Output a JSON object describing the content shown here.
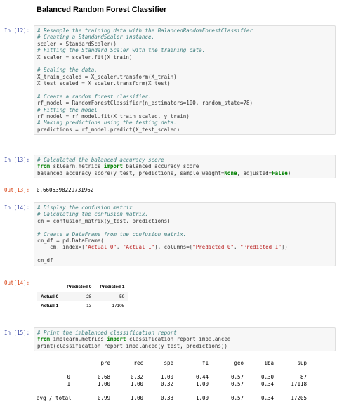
{
  "title": "Balanced Random Forest Classifier",
  "cell12": {
    "prompt": "In [12]:",
    "lines": [
      "# Resample the training data with the BalancedRandomForestClassifier",
      "# Creating a StandardScaler instance.",
      "scaler = StandardScaler()",
      "# Fitting the Standard Scaler with the training data.",
      "X_scaler = scaler.fit(X_train)",
      "",
      "# Scaling the data.",
      "X_train_scaled = X_scaler.transform(X_train)",
      "X_test_scaled = X_scaler.transform(X_test)",
      "",
      "# Create a random forest classifier.",
      "rf_model = RandomForestClassifier(n_estimators=100, random_state=78)",
      "# Fitting the model",
      "rf_model = rf_model.fit(X_train_scaled, y_train)",
      "# Making predictions using the testing data.",
      "predictions = rf_model.predict(X_test_scaled)"
    ]
  },
  "cell13": {
    "prompt": "In [13]:",
    "lines": [
      "# Calculated the balanced accuracy score",
      "from sklearn.metrics import balanced_accuracy_score",
      "balanced_accuracy_score(y_test, predictions, sample_weight=None, adjusted=False)"
    ],
    "out_prompt": "Out[13]:",
    "output": "0.6605398229731962"
  },
  "cell14": {
    "prompt": "In [14]:",
    "lines": [
      "# Display the confusion matrix",
      "# Calculating the confusion matrix.",
      "cm = confusion_matrix(y_test, predictions)",
      "",
      "# Create a DataFrame from the confusion matrix.",
      "cm_df = pd.DataFrame(",
      "    cm, index=[\"Actual 0\", \"Actual 1\"], columns=[\"Predicted 0\", \"Predicted 1\"])",
      "",
      "cm_df"
    ],
    "out_prompt": "Out[14]:",
    "table": {
      "columns": [
        "",
        "Predicted 0",
        "Predicted 1"
      ],
      "rows": [
        {
          "label": "Actual 0",
          "p0": "28",
          "p1": "59"
        },
        {
          "label": "Actual 1",
          "p0": "13",
          "p1": "17105"
        }
      ]
    }
  },
  "cell15": {
    "prompt": "In [15]:",
    "lines": [
      "# Print the imbalanced classification report",
      "from imblearn.metrics import classification_report_imbalanced",
      "print(classification_report_imbalanced(y_test, predictions))"
    ],
    "report": {
      "headers": [
        "pre",
        "rec",
        "spe",
        "f1",
        "geo",
        "iba",
        "sup"
      ],
      "rows": [
        {
          "label": "0",
          "values": [
            "0.68",
            "0.32",
            "1.00",
            "0.44",
            "0.57",
            "0.30",
            "87"
          ]
        },
        {
          "label": "1",
          "values": [
            "1.00",
            "1.00",
            "0.32",
            "1.00",
            "0.57",
            "0.34",
            "17118"
          ]
        },
        {
          "label": "avg / total",
          "values": [
            "0.99",
            "1.00",
            "0.33",
            "1.00",
            "0.57",
            "0.34",
            "17205"
          ]
        }
      ]
    }
  }
}
